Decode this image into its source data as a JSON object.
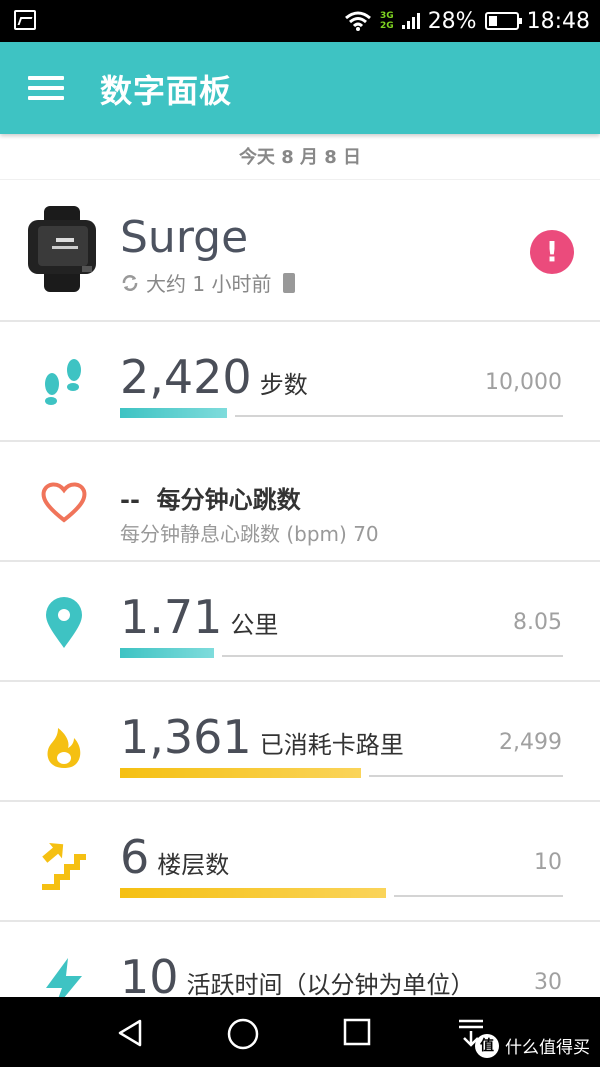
{
  "status_bar": {
    "network_top": "3G",
    "network_bottom": "2G",
    "battery_percent": "28%",
    "time": "18:48",
    "icons": [
      "gallery-icon",
      "wifi-icon",
      "signal-icon",
      "battery-icon"
    ]
  },
  "app_bar": {
    "title": "数字面板",
    "menu_icon": "hamburger-menu-icon"
  },
  "date_header": "今天 8 月 8 日",
  "device": {
    "name": "Surge",
    "sync_status": "大约 1 小时前",
    "alert_symbol": "!",
    "alert_color": "#eb4b7c"
  },
  "metrics": {
    "steps": {
      "value": "2,420",
      "unit": "步数",
      "goal": "10,000",
      "progress": 0.242,
      "color": "#3ec3c3",
      "icon": "footsteps-icon"
    },
    "heart": {
      "value": "--",
      "unit": "每分钟心跳数",
      "resting_label": "每分钟静息心跳数 (bpm) 70",
      "color": "#f0745a",
      "icon": "heart-icon"
    },
    "distance": {
      "value": "1.71",
      "unit": "公里",
      "goal": "8.05",
      "progress": 0.212,
      "color": "#3ec3c3",
      "icon": "location-pin-icon"
    },
    "calories": {
      "value": "1,361",
      "unit": "已消耗卡路里",
      "goal": "2,499",
      "progress": 0.545,
      "color": "#f5c012",
      "icon": "flame-icon"
    },
    "floors": {
      "value": "6",
      "unit": "楼层数",
      "goal": "10",
      "progress": 0.6,
      "color": "#f5c012",
      "icon": "stairs-icon"
    },
    "active": {
      "value": "10",
      "unit": "活跃时间（以分钟为单位）",
      "goal": "30",
      "color": "#3ec3c3",
      "icon": "lightning-icon"
    }
  },
  "nav_bar": {
    "watermark": "什么值得买",
    "watermark_logo": "值"
  }
}
